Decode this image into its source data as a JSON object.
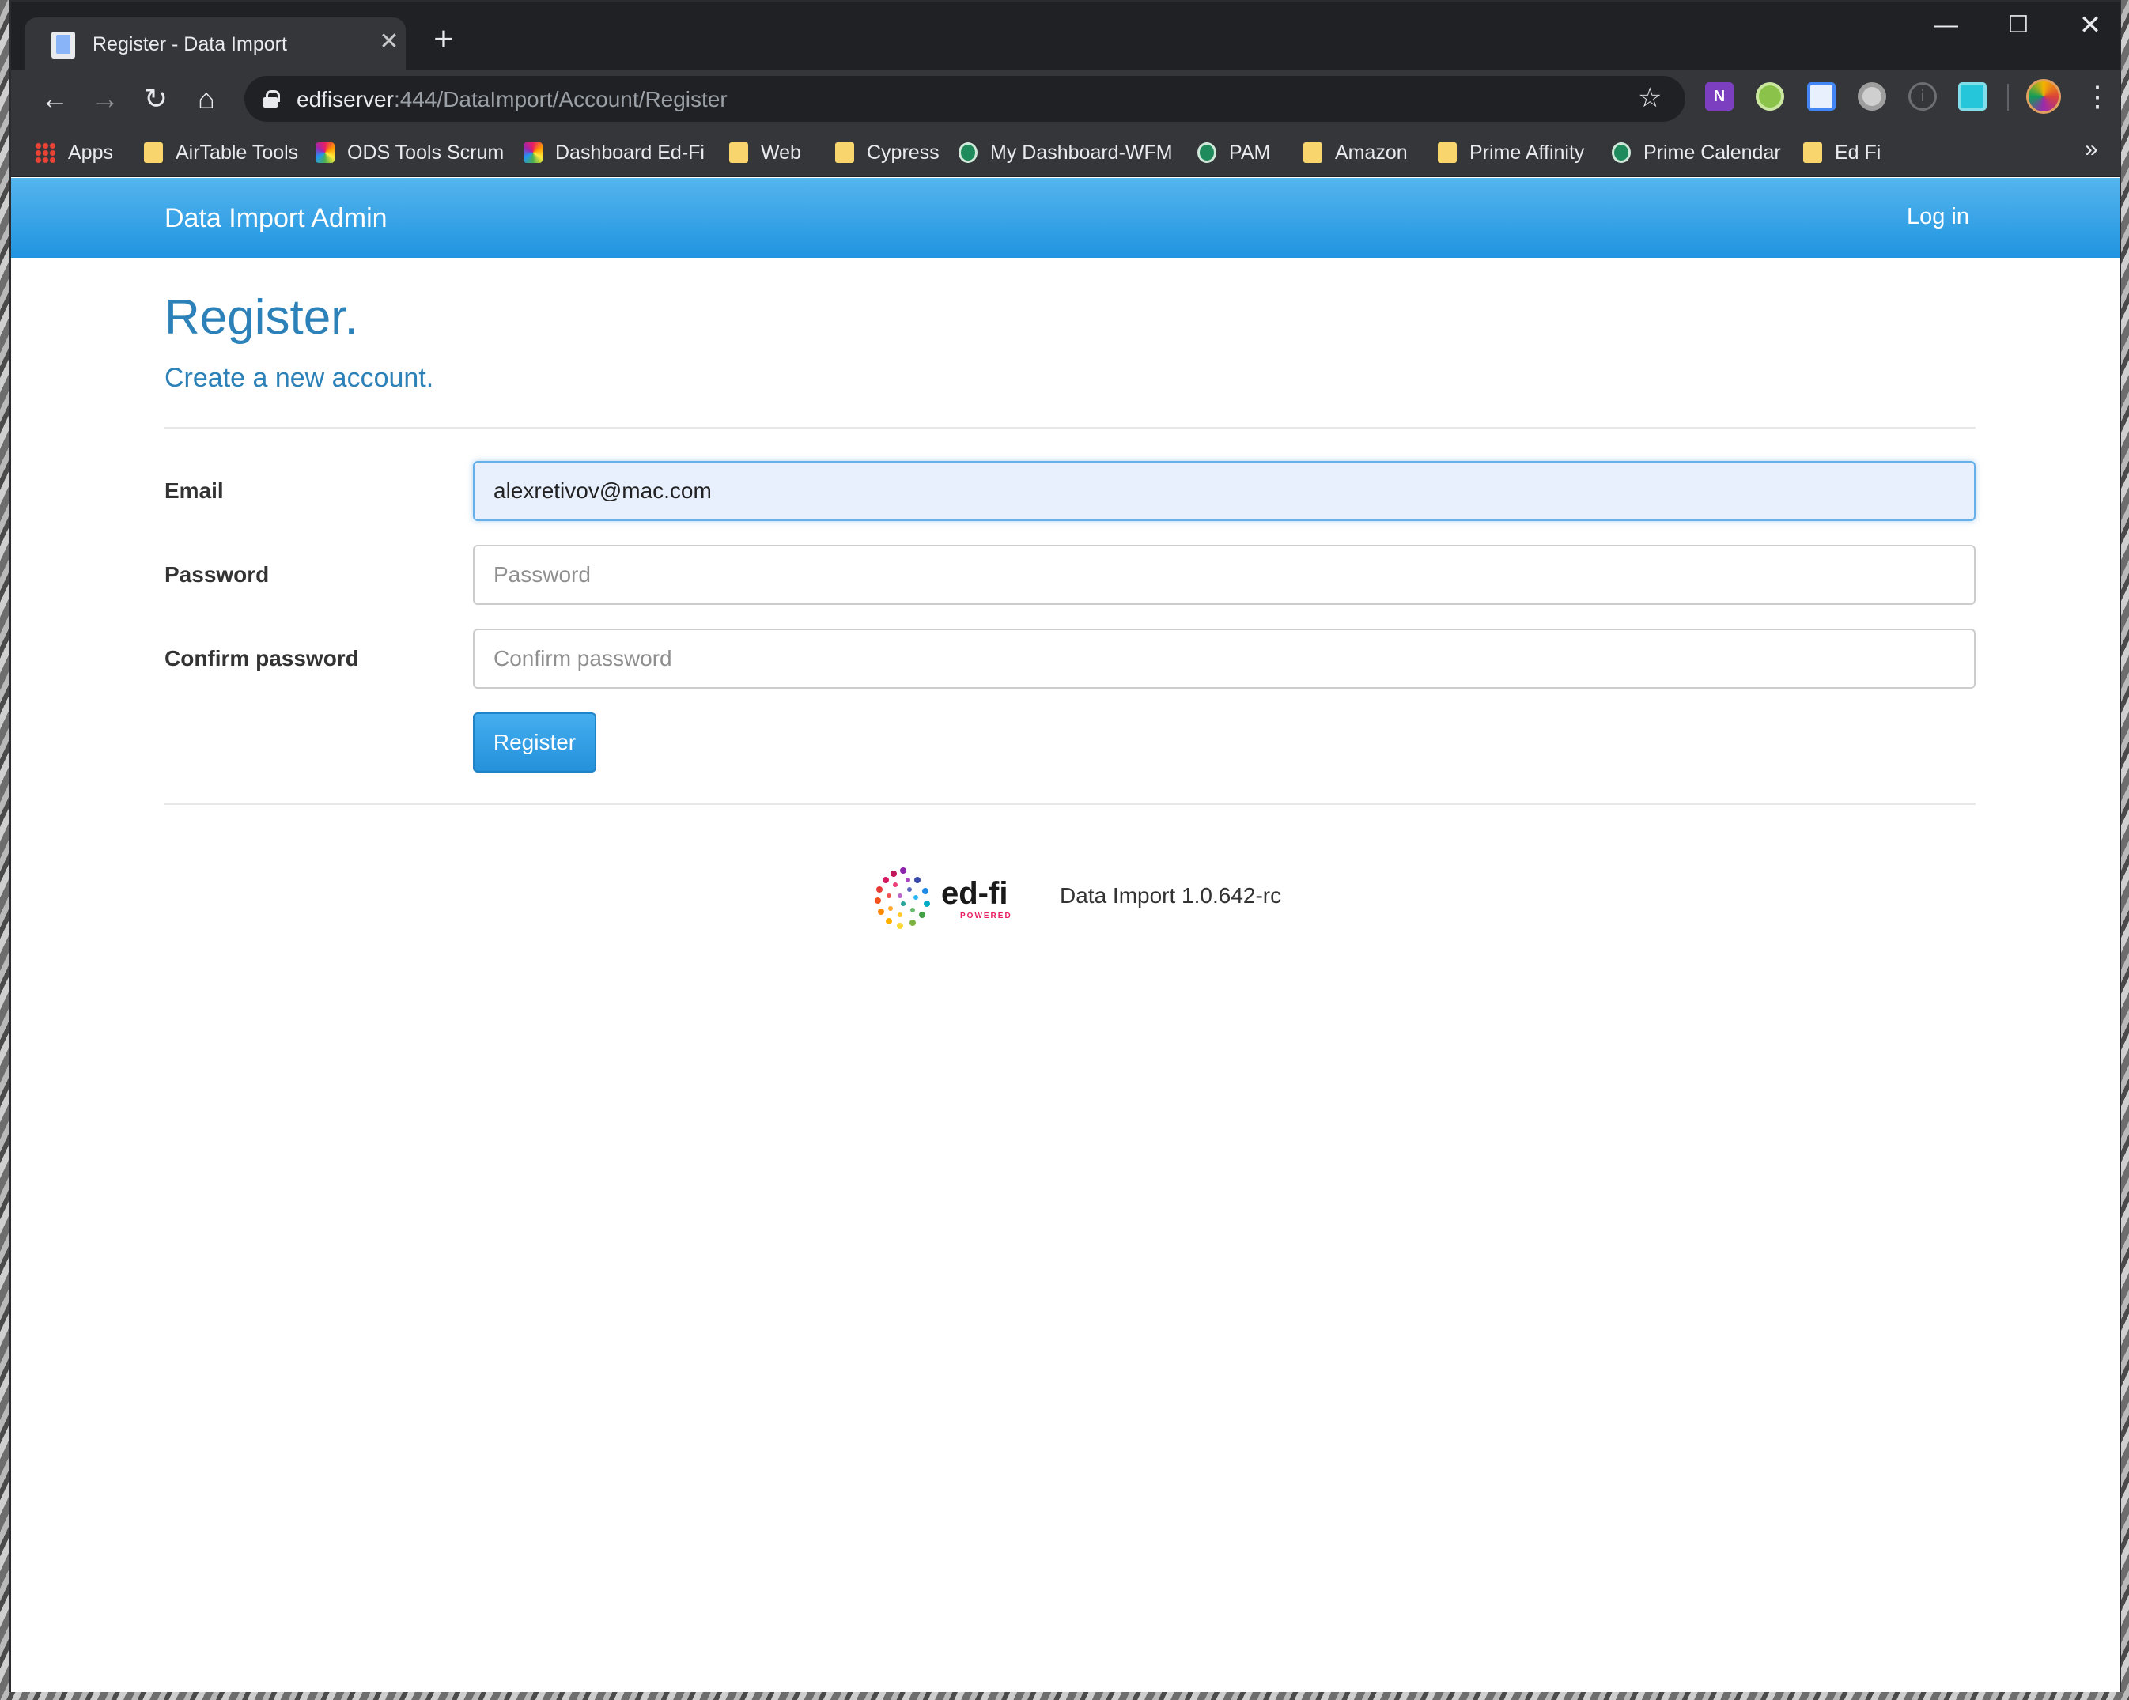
{
  "browser": {
    "tab_title": "Register - Data Import",
    "new_tab_label": "+",
    "url_host": "edfiserver",
    "url_path": ":444/DataImport/Account/Register",
    "bookmarks": [
      {
        "label": "Apps",
        "icon": "apps-grid-icon"
      },
      {
        "label": "AirTable Tools",
        "icon": "folder-icon"
      },
      {
        "label": "ODS Tools Scrum",
        "icon": "edfi-icon"
      },
      {
        "label": "Dashboard Ed-Fi",
        "icon": "edfi-icon"
      },
      {
        "label": "Web",
        "icon": "folder-icon"
      },
      {
        "label": "Cypress",
        "icon": "folder-icon"
      },
      {
        "label": "My Dashboard-WFM",
        "icon": "wfm-icon"
      },
      {
        "label": "PAM",
        "icon": "wfm-icon"
      },
      {
        "label": "Amazon",
        "icon": "folder-icon"
      },
      {
        "label": "Prime Affinity",
        "icon": "folder-icon"
      },
      {
        "label": "Prime Calendar",
        "icon": "wfm-icon"
      },
      {
        "label": "Ed Fi",
        "icon": "folder-icon"
      }
    ],
    "bookmarks_overflow": "»"
  },
  "navbar": {
    "brand": "Data Import Admin",
    "login_link": "Log in",
    "color_top": "#55b5ee",
    "color_bottom": "#2094e0"
  },
  "page": {
    "title": "Register.",
    "subtitle": "Create a new account."
  },
  "form": {
    "email_label": "Email",
    "email_value": "alexretivov@mac.com",
    "password_label": "Password",
    "password_placeholder": "Password",
    "confirm_label": "Confirm password",
    "confirm_placeholder": "Confirm password",
    "submit_label": "Register"
  },
  "footer": {
    "logo_text": "ed-fi",
    "logo_subtext": "POWERED",
    "version": "Data Import 1.0.642-rc"
  }
}
